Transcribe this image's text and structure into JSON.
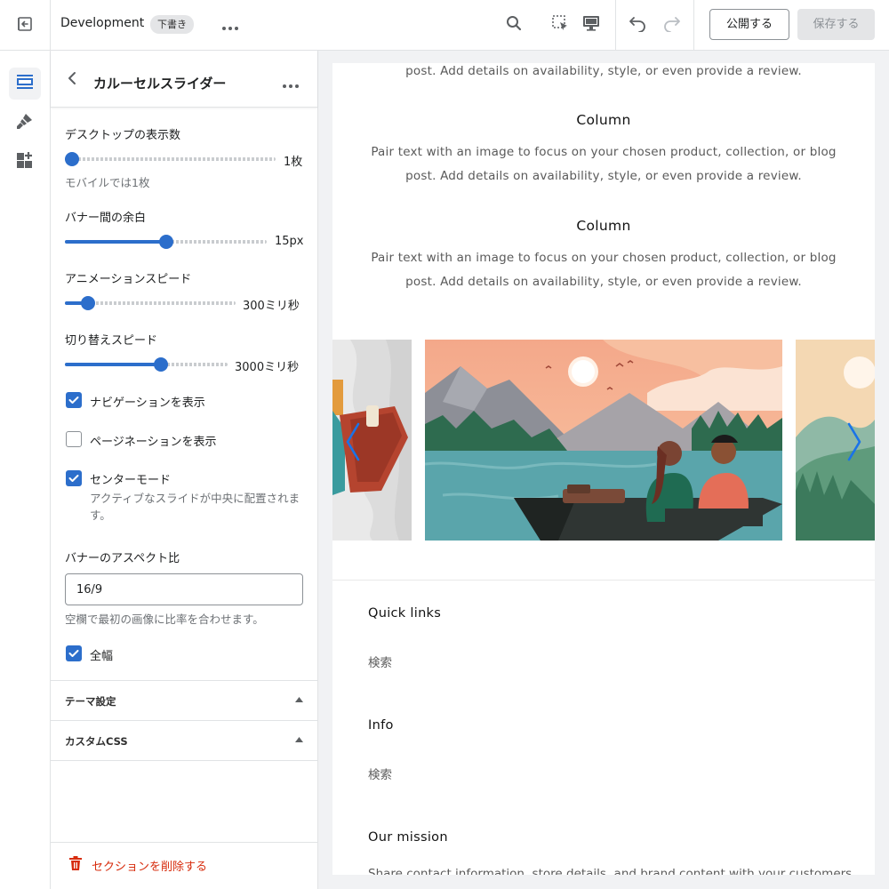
{
  "topbar": {
    "theme_name": "Development",
    "status_badge": "下書き",
    "publish_label": "公開する",
    "save_label": "保存する"
  },
  "panel": {
    "title": "カルーセルスライダー",
    "settings": {
      "desktop_count_label": "デスクトップの表示数",
      "desktop_count_value": "1枚",
      "desktop_count_level": 0.0,
      "mobile_help": "モバイルでは1枚",
      "gap_label": "バナー間の余白",
      "gap_value": "15px",
      "gap_level": 0.5,
      "anim_speed_label": "アニメーションスピード",
      "anim_speed_value": "300ミリ秒",
      "anim_speed_level": 0.1,
      "switch_speed_label": "切り替えスピード",
      "switch_speed_value": "3000ミリ秒",
      "switch_speed_level": 0.6,
      "show_nav_label": "ナビゲーションを表示",
      "show_nav_checked": true,
      "show_pagination_label": "ページネーションを表示",
      "show_pagination_checked": false,
      "center_mode_label": "センターモード",
      "center_mode_checked": true,
      "center_mode_help": "アクティブなスライドが中央に配置されます。",
      "aspect_label": "バナーのアスペクト比",
      "aspect_value": "16/9",
      "aspect_help": "空欄で最初の画像に比率を合わせます。",
      "full_width_label": "全幅",
      "full_width_checked": true
    },
    "accordions": [
      "テーマ設定",
      "カスタムCSS"
    ],
    "delete_label": "セクションを削除する"
  },
  "preview": {
    "partial_text": "post. Add details on availability, style, or even provide a review.",
    "columns": [
      {
        "title": "Column",
        "text": "Pair text with an image to focus on your chosen product, collection, or blog post. Add details on availability, style, or even provide a review."
      },
      {
        "title": "Column",
        "text": "Pair text with an image to focus on your chosen product, collection, or blog post. Add details on availability, style, or even provide a review."
      }
    ],
    "footer": [
      {
        "heading": "Quick links",
        "link": "検索"
      },
      {
        "heading": "Info",
        "link": "検索"
      },
      {
        "heading": "Our mission",
        "text": "Share contact information, store details, and brand content with your customers."
      }
    ]
  },
  "colors": {
    "accent": "#2c6ecb",
    "danger": "#d72c0d",
    "slider_arrow": "#1a73e8"
  },
  "icons": [
    "exit-icon",
    "search-icon",
    "inspector-icon",
    "desktop-icon",
    "undo-icon",
    "redo-icon",
    "sections-icon",
    "theme-brush-icon",
    "apps-icon",
    "back-icon",
    "more-icon",
    "caret-up-icon",
    "trash-icon",
    "chevron-left-icon",
    "chevron-right-icon"
  ]
}
